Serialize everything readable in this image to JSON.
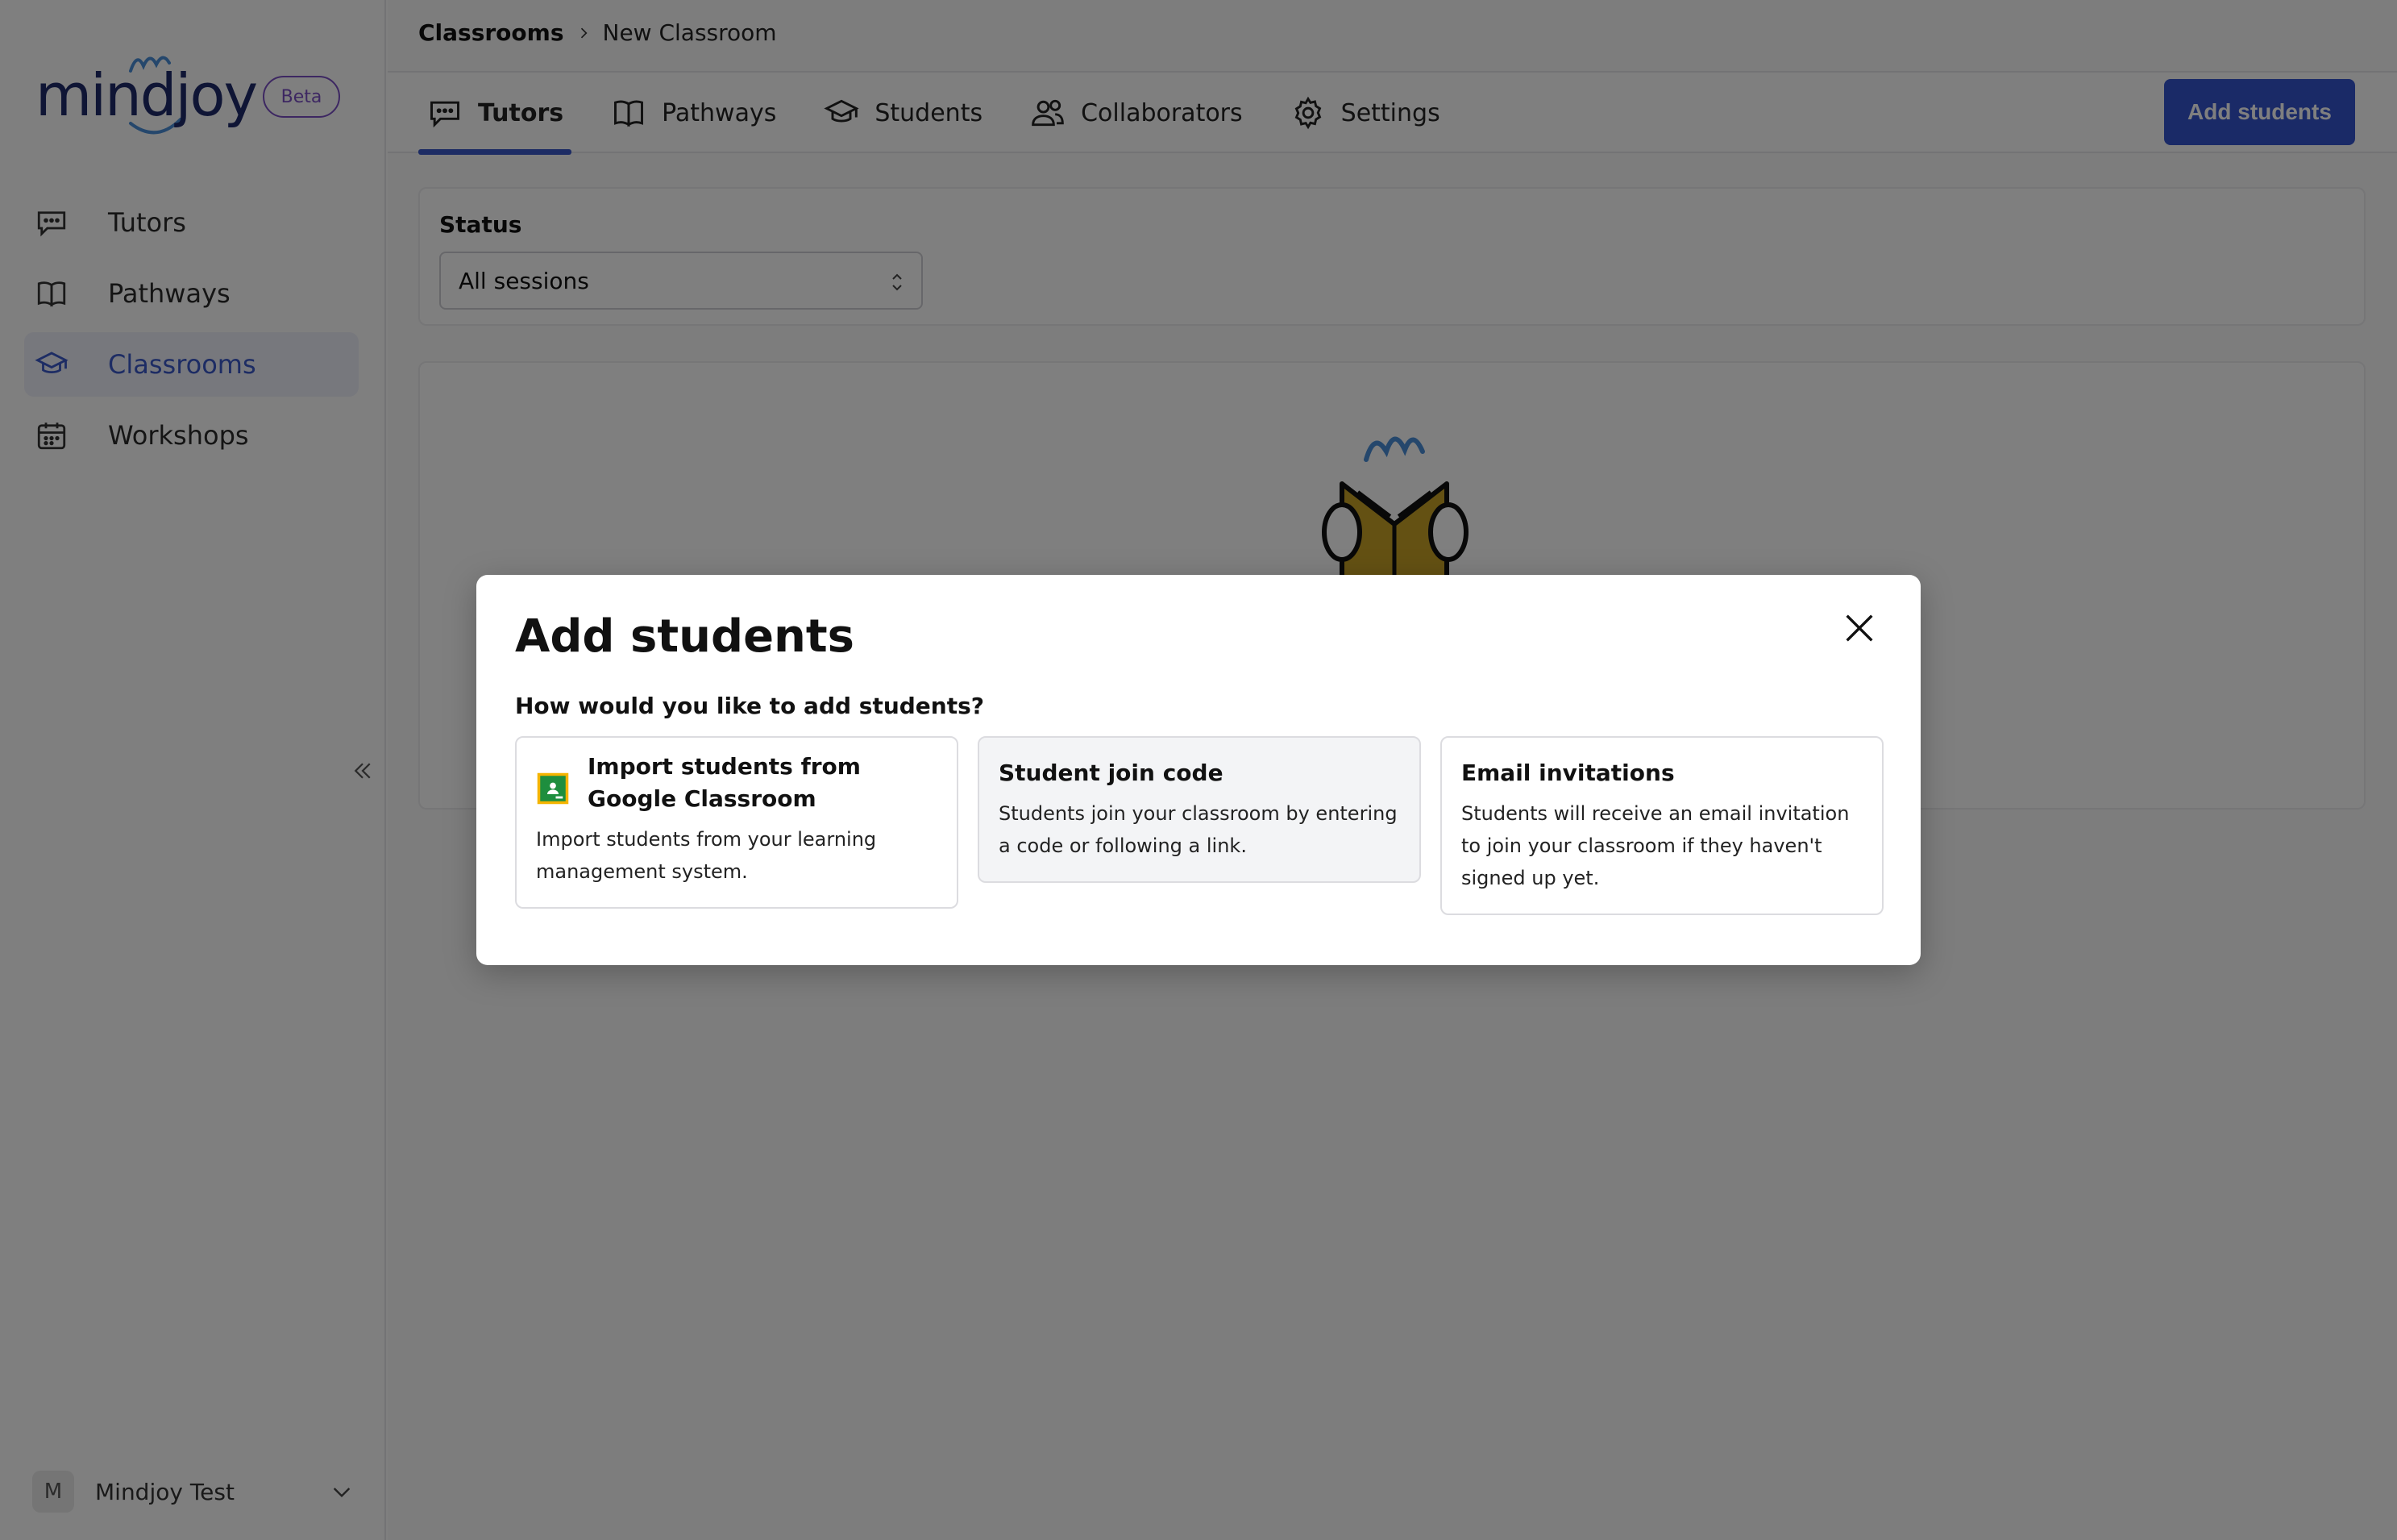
{
  "sidebar": {
    "logo_text": "mindjoy",
    "beta_badge": "Beta",
    "items": [
      {
        "label": "Tutors",
        "icon": "chat-icon"
      },
      {
        "label": "Pathways",
        "icon": "book-icon"
      },
      {
        "label": "Classrooms",
        "icon": "graduation-cap-icon",
        "active": true
      },
      {
        "label": "Workshops",
        "icon": "calendar-icon"
      }
    ],
    "user": {
      "initial": "M",
      "name": "Mindjoy Test"
    }
  },
  "breadcrumb": {
    "root": "Classrooms",
    "current": "New Classroom"
  },
  "tabs": [
    {
      "label": "Tutors",
      "icon": "chat-icon",
      "active": true
    },
    {
      "label": "Pathways",
      "icon": "book-icon"
    },
    {
      "label": "Students",
      "icon": "graduation-cap-icon"
    },
    {
      "label": "Collaborators",
      "icon": "users-icon"
    },
    {
      "label": "Settings",
      "icon": "gear-icon"
    }
  ],
  "header": {
    "add_students_label": "Add students"
  },
  "filter": {
    "label": "Status",
    "selected": "All sessions"
  },
  "modal": {
    "title": "Add students",
    "question": "How would you like to add students?",
    "options": [
      {
        "title": "Import students from Google Classroom",
        "description": "Import students from your learning management system.",
        "icon": "google-classroom-icon"
      },
      {
        "title": "Student join code",
        "description": "Students join your classroom by entering a code or following a link."
      },
      {
        "title": "Email invitations",
        "description": "Students will receive an email invitation to join your classroom if they haven't signed up yet."
      }
    ]
  },
  "colors": {
    "accent": "#3554cf",
    "active_nav": "#3a58c9",
    "beta": "#7a4fc4",
    "overlay": "rgba(0,0,0,0.5)"
  }
}
